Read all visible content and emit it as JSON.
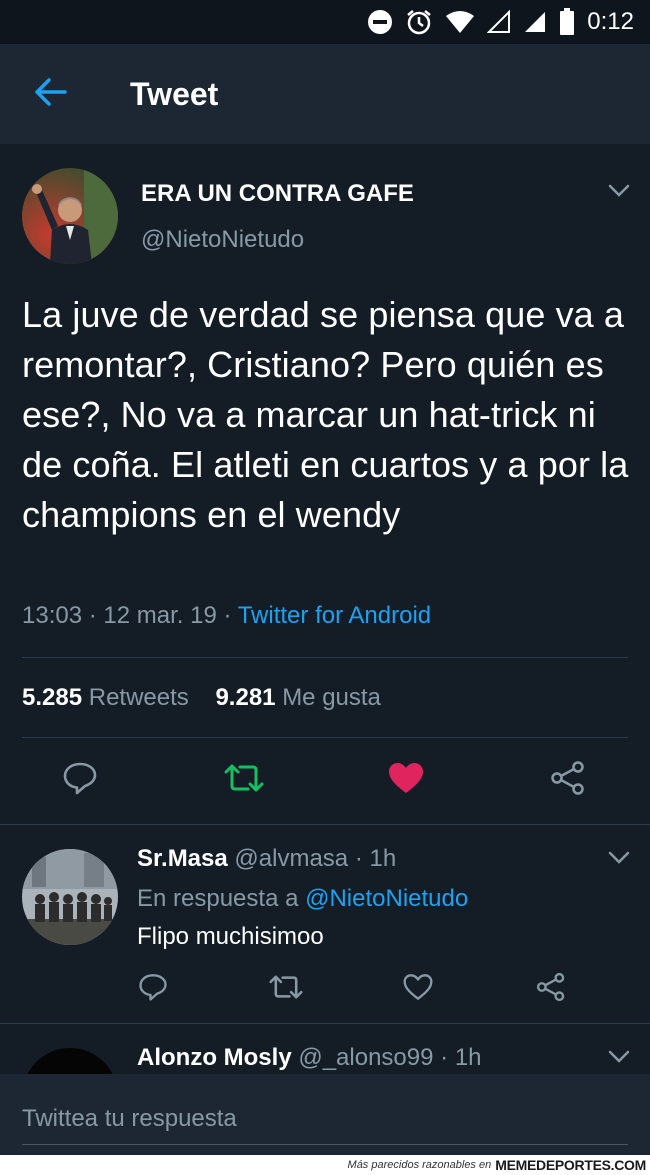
{
  "status_bar": {
    "time": "0:12"
  },
  "header": {
    "title": "Tweet"
  },
  "tweet": {
    "author_name": "ERA UN CONTRA GAFE",
    "author_handle": "@NietoNietudo",
    "text": "La juve de verdad se piensa que va a remontar?, Cristiano? Pero quién es ese?, No va a marcar un hat-trick ni de coña. El atleti en cuartos y a por la champions en el wendy",
    "time": "13:03",
    "date": "12 mar. 19",
    "client": "Twitter for Android",
    "retweets_count": "5.285",
    "retweets_label": "Retweets",
    "likes_count": "9.281",
    "likes_label": "Me gusta",
    "liked": true,
    "retweeted": true
  },
  "replies": [
    {
      "name": "Sr.Masa",
      "handle": "@alvmasa",
      "time": "1h",
      "reply_prefix": "En respuesta a",
      "reply_to": "@NietoNietudo",
      "text": "Flipo muchisimoo"
    },
    {
      "name": "Alonzo Mosly",
      "handle": "@_alonso99",
      "time": "1h"
    }
  ],
  "compose": {
    "placeholder": "Twittea tu respuesta"
  },
  "watermark": {
    "tagline": "Más parecidos razonables en",
    "brand": "MEMEDEPORTES.COM"
  },
  "colors": {
    "background": "#141d26",
    "header_bg": "#1c2733",
    "secondary_text": "#8899a6",
    "link": "#1da1f2",
    "retweet_active": "#17bf63",
    "like_active": "#e0245e"
  },
  "icons": [
    "arrow-back-icon",
    "chevron-down-icon",
    "reply-icon",
    "retweet-icon",
    "heart-icon",
    "share-icon"
  ]
}
